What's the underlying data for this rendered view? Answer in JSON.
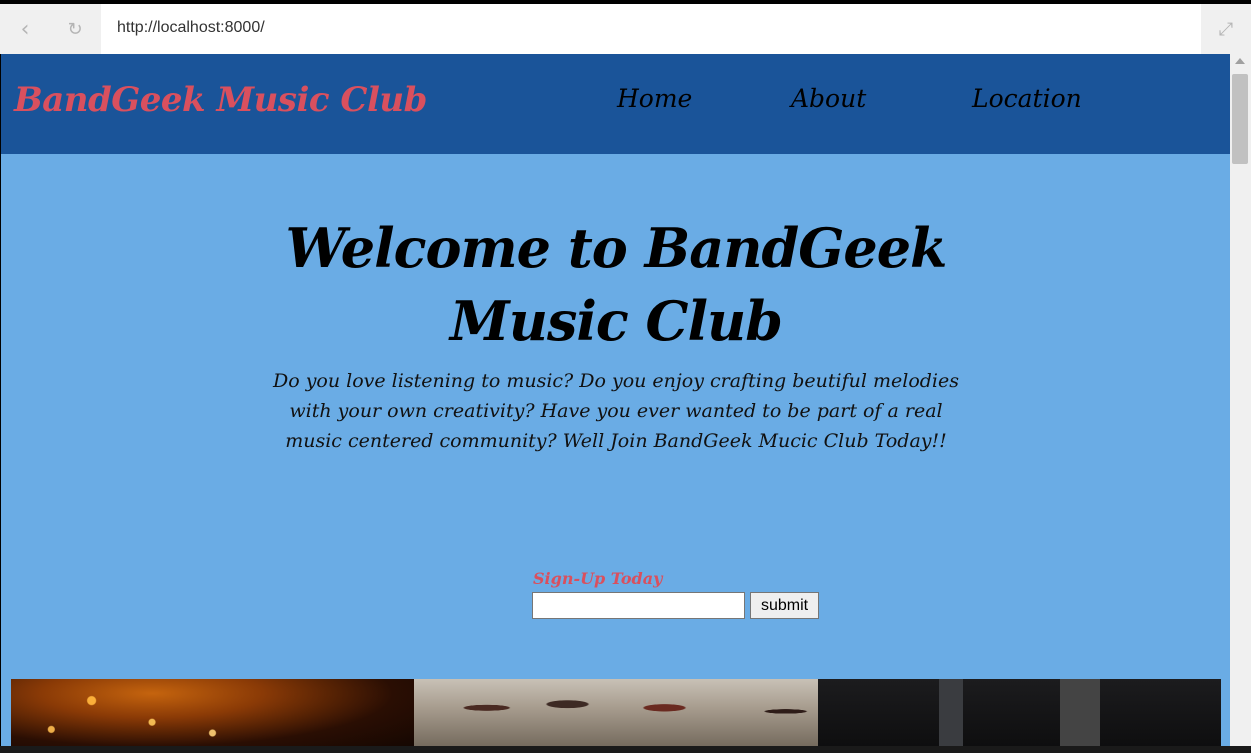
{
  "browser": {
    "url": "http://localhost:8000/",
    "back_icon": "chevron-left-icon",
    "refresh_icon": "refresh-icon",
    "expand_icon": "expand-icon"
  },
  "header": {
    "brand": "BandGeek Music Club",
    "nav": [
      {
        "label": "Home"
      },
      {
        "label": "About"
      },
      {
        "label": "Location"
      }
    ]
  },
  "hero": {
    "title": "Welcome to BandGeek Music Club",
    "text": "Do you love listening to music? Do you enjoy crafting beutiful melodies with your own creativity? Have you ever wanted to be part of a real music centered community? Well Join BandGeek Mucic Club Today!!"
  },
  "signup": {
    "label": "Sign-Up Today",
    "input_value": "",
    "submit_label": "submit"
  },
  "colors": {
    "header_bg": "#1a5499",
    "page_bg": "#6aace5",
    "accent": "#d9505e"
  }
}
